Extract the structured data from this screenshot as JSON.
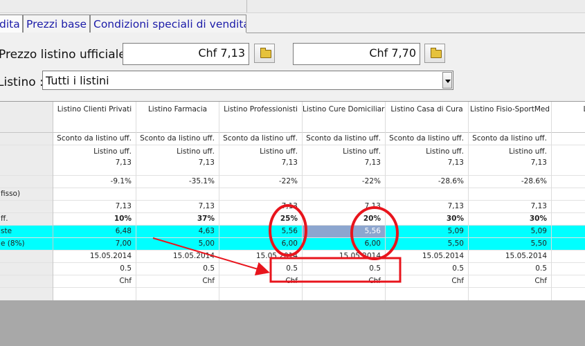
{
  "tabs": [
    {
      "label": "dita"
    },
    {
      "label": "Prezzi base"
    },
    {
      "label": "Condizioni speciali di vendita"
    }
  ],
  "price_label": "Prezzo listino ufficiale :",
  "price_fields": [
    {
      "value": "Chf 7,13"
    },
    {
      "value": "Chf 7,70"
    }
  ],
  "listino_label": "Listino :",
  "listino_select": "Tutti i listini",
  "row_labels": [
    "",
    "",
    "",
    "fisso)",
    "",
    "ff.",
    "ste",
    "e (8%)",
    "",
    "",
    "",
    ""
  ],
  "columns": [
    {
      "header": "Listino Clienti Privati",
      "sconto": "Sconto da listino uff.",
      "base_line1": "Listino uff.",
      "base_line2": "7,13",
      "pct": "-9.1%",
      "fisso": "",
      "uff": "7,13",
      "discount": "10%",
      "net": "6,48",
      "vat": "7,00",
      "date": "15.05.2014",
      "round": "0.5",
      "currency": "Chf"
    },
    {
      "header": "Listino Farmacia",
      "sconto": "Sconto da listino uff.",
      "base_line1": "Listino uff.",
      "base_line2": "7,13",
      "pct": "-35.1%",
      "fisso": "",
      "uff": "7,13",
      "discount": "37%",
      "net": "4,63",
      "vat": "5,00",
      "date": "15.05.2014",
      "round": "0.5",
      "currency": "Chf"
    },
    {
      "header": "Listino Professionisti",
      "sconto": "Sconto da listino uff.",
      "base_line1": "Listino uff.",
      "base_line2": "7,13",
      "pct": "-22%",
      "fisso": "",
      "uff": "7,13",
      "discount": "25%",
      "net": "5,56",
      "vat": "6,00",
      "date": "15.05.2014",
      "round": "0.5",
      "currency": "Chf"
    },
    {
      "header": "Listino Cure Domiciliari",
      "sconto": "Sconto da listino uff.",
      "base_line1": "Listino uff.",
      "base_line2": "7,13",
      "pct": "-22%",
      "fisso": "",
      "uff": "7,13",
      "discount": "20%",
      "net": "5,56",
      "vat": "6,00",
      "date": "15.05.2014",
      "round": "0.5",
      "currency": "Chf"
    },
    {
      "header": "Listino Casa di Cura",
      "sconto": "Sconto da listino uff.",
      "base_line1": "Listino uff.",
      "base_line2": "7,13",
      "pct": "-28.6%",
      "fisso": "",
      "uff": "7,13",
      "discount": "30%",
      "net": "5,09",
      "vat": "5,50",
      "date": "15.05.2014",
      "round": "0.5",
      "currency": "Chf"
    },
    {
      "header": "Listino Fisio-SportMed",
      "sconto": "Sconto da listino uff.",
      "base_line1": "Listino uff.",
      "base_line2": "7,13",
      "pct": "-28.6%",
      "fisso": "",
      "uff": "7,13",
      "discount": "30%",
      "net": "5,09",
      "vat": "5,50",
      "date": "15.05.2014",
      "round": "0.5",
      "currency": "Chf"
    },
    {
      "header": "Listin",
      "sconto": "Sconto",
      "base_line1": "",
      "base_line2": "",
      "pct": "",
      "fisso": "",
      "uff": "",
      "discount": "",
      "net": "",
      "vat": "",
      "date": "",
      "round": "",
      "currency": ""
    }
  ],
  "colors": {
    "highlight_row": "#00ffff",
    "selected_cell": "#8ca6cf",
    "annotation": "#e8141c"
  }
}
